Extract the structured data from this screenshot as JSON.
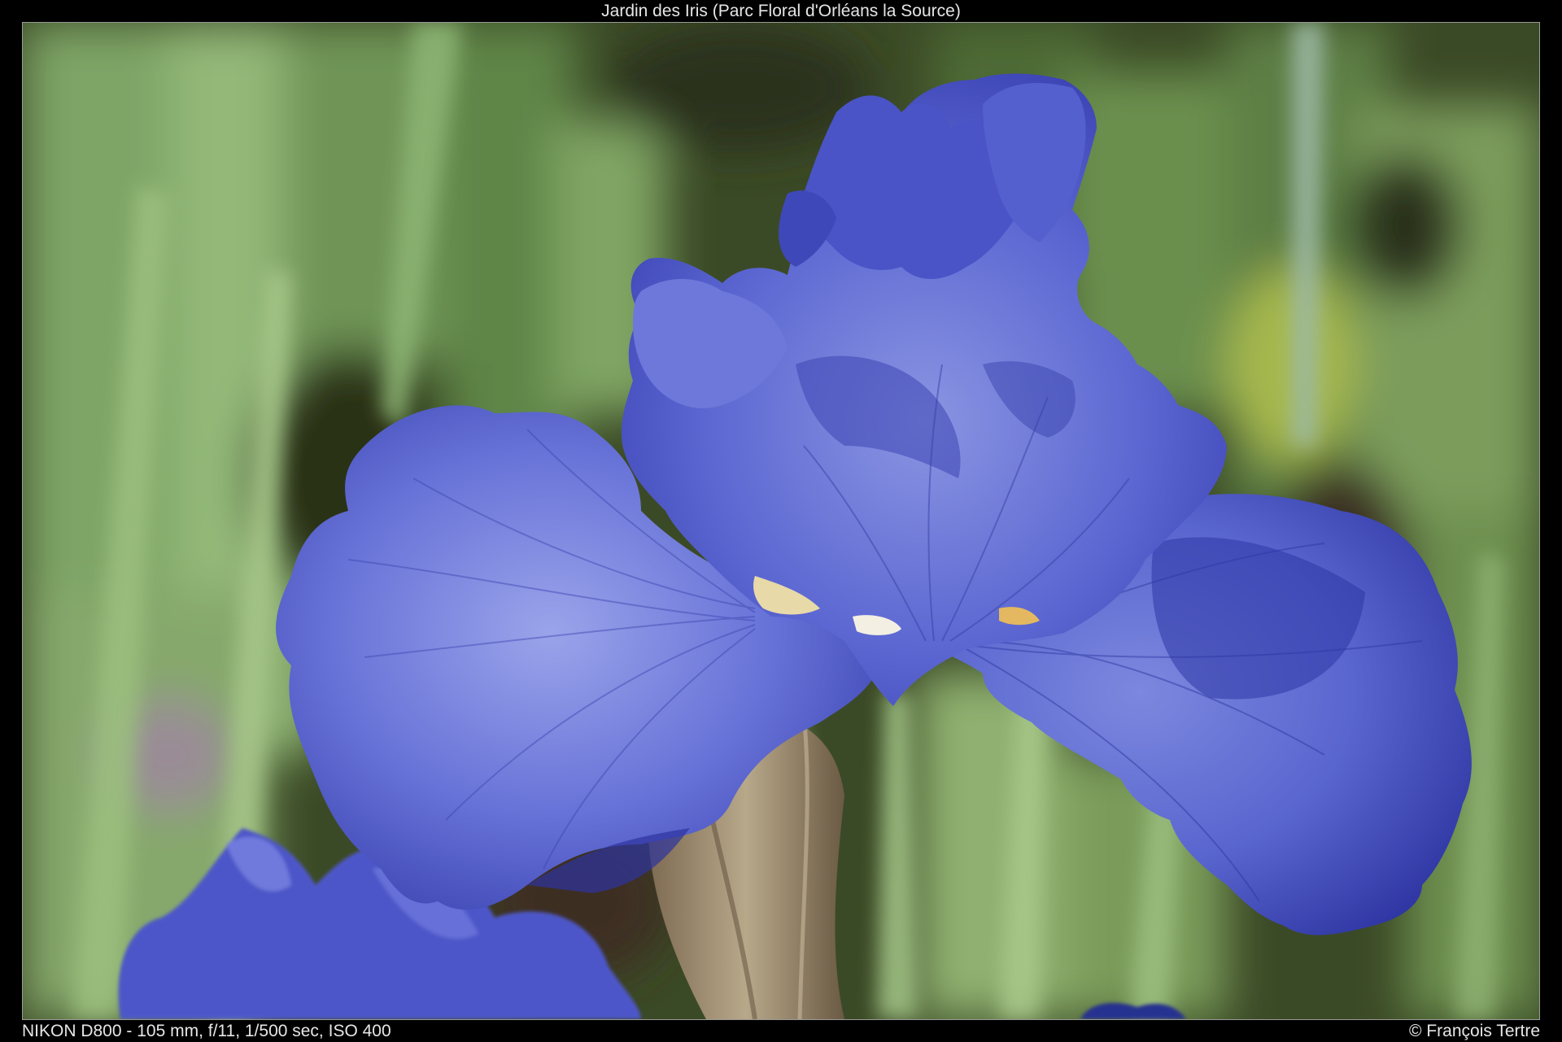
{
  "photo": {
    "title": "Jardin des Iris (Parc Floral d'Orléans la Source)",
    "exif": "NIKON D800 - 105 mm, f/11, 1/500 sec, ISO 400",
    "credit": "© François Tertre",
    "subject": "iris-flower",
    "colors": {
      "petal": "#5a68d6",
      "petal_light": "#8f9ae6",
      "petal_dark": "#2f35a8",
      "foliage": "#6f9a58",
      "foliage_dark": "#2c3a1c",
      "border": "#9a9a9a",
      "caption_text": "#e6e6e6"
    }
  }
}
